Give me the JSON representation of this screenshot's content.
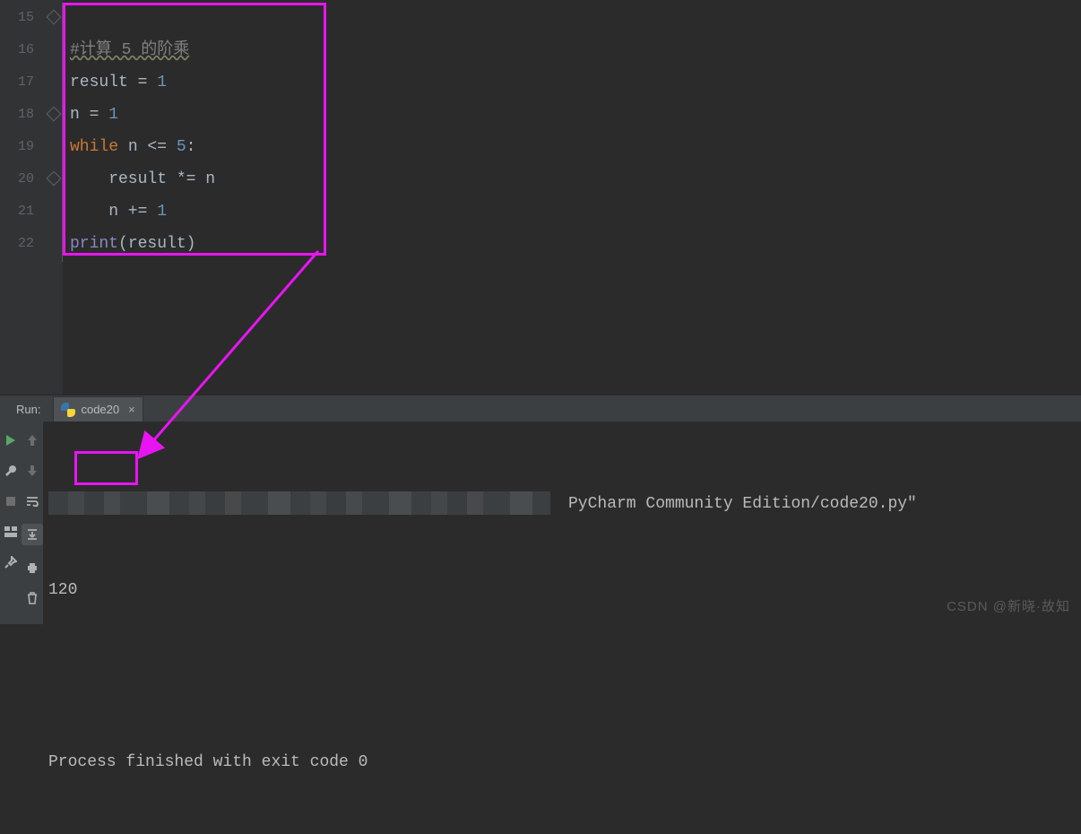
{
  "editor": {
    "line_numbers": [
      "15",
      "16",
      "17",
      "18",
      "19",
      "20",
      "21",
      "22"
    ],
    "code": {
      "l15": "#计算 5 的阶乘",
      "l16a": "result ",
      "l16b": "= ",
      "l16c": "1",
      "l17a": "n ",
      "l17b": "= ",
      "l17c": "1",
      "l18a": "while ",
      "l18b": "n <= ",
      "l18c": "5",
      "l18d": ":",
      "l19": "    result *= n",
      "l20a": "    n += ",
      "l20b": "1",
      "l21a": "print",
      "l21b": "(result)"
    }
  },
  "run": {
    "label": "Run:",
    "tab_name": "code20",
    "path_suffix": "PyCharm Community Edition/code20.py\"",
    "output": "120",
    "exit_line": "Process finished with exit code 0"
  },
  "watermark": "CSDN @新晓·故知"
}
